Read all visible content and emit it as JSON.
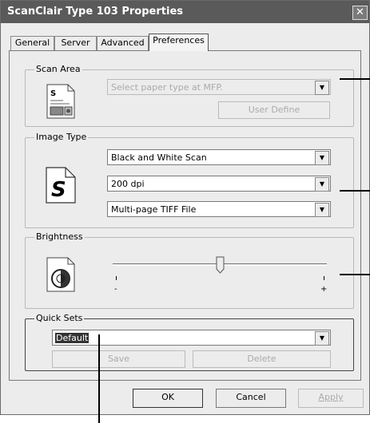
{
  "window": {
    "title": "ScanClair Type 103 Properties",
    "close_glyph": "✕"
  },
  "tabs": [
    {
      "label": "General"
    },
    {
      "label": "Server"
    },
    {
      "label": "Advanced"
    },
    {
      "label": "Preferences"
    }
  ],
  "scan_area": {
    "legend": "Scan Area",
    "paper_type_value": "Select paper type at MFP.",
    "user_define_label": "User Define",
    "icon": "document-scan-icon"
  },
  "image_type": {
    "legend": "Image Type",
    "icon": "s-document-icon",
    "icon_glyph": "S",
    "scan_mode_value": "Black and White Scan",
    "resolution_value": "200 dpi",
    "file_format_value": "Multi-page TIFF File"
  },
  "brightness": {
    "legend": "Brightness",
    "icon": "brightness-icon",
    "level_fraction": 0.5,
    "minus_label": "-",
    "plus_label": "+"
  },
  "quick_sets": {
    "legend": "Quick Sets",
    "selected_value": "Default",
    "save_label": "Save",
    "delete_label": "Delete"
  },
  "footer": {
    "ok_label": "OK",
    "cancel_label": "Cancel",
    "apply_label": "Apply"
  }
}
